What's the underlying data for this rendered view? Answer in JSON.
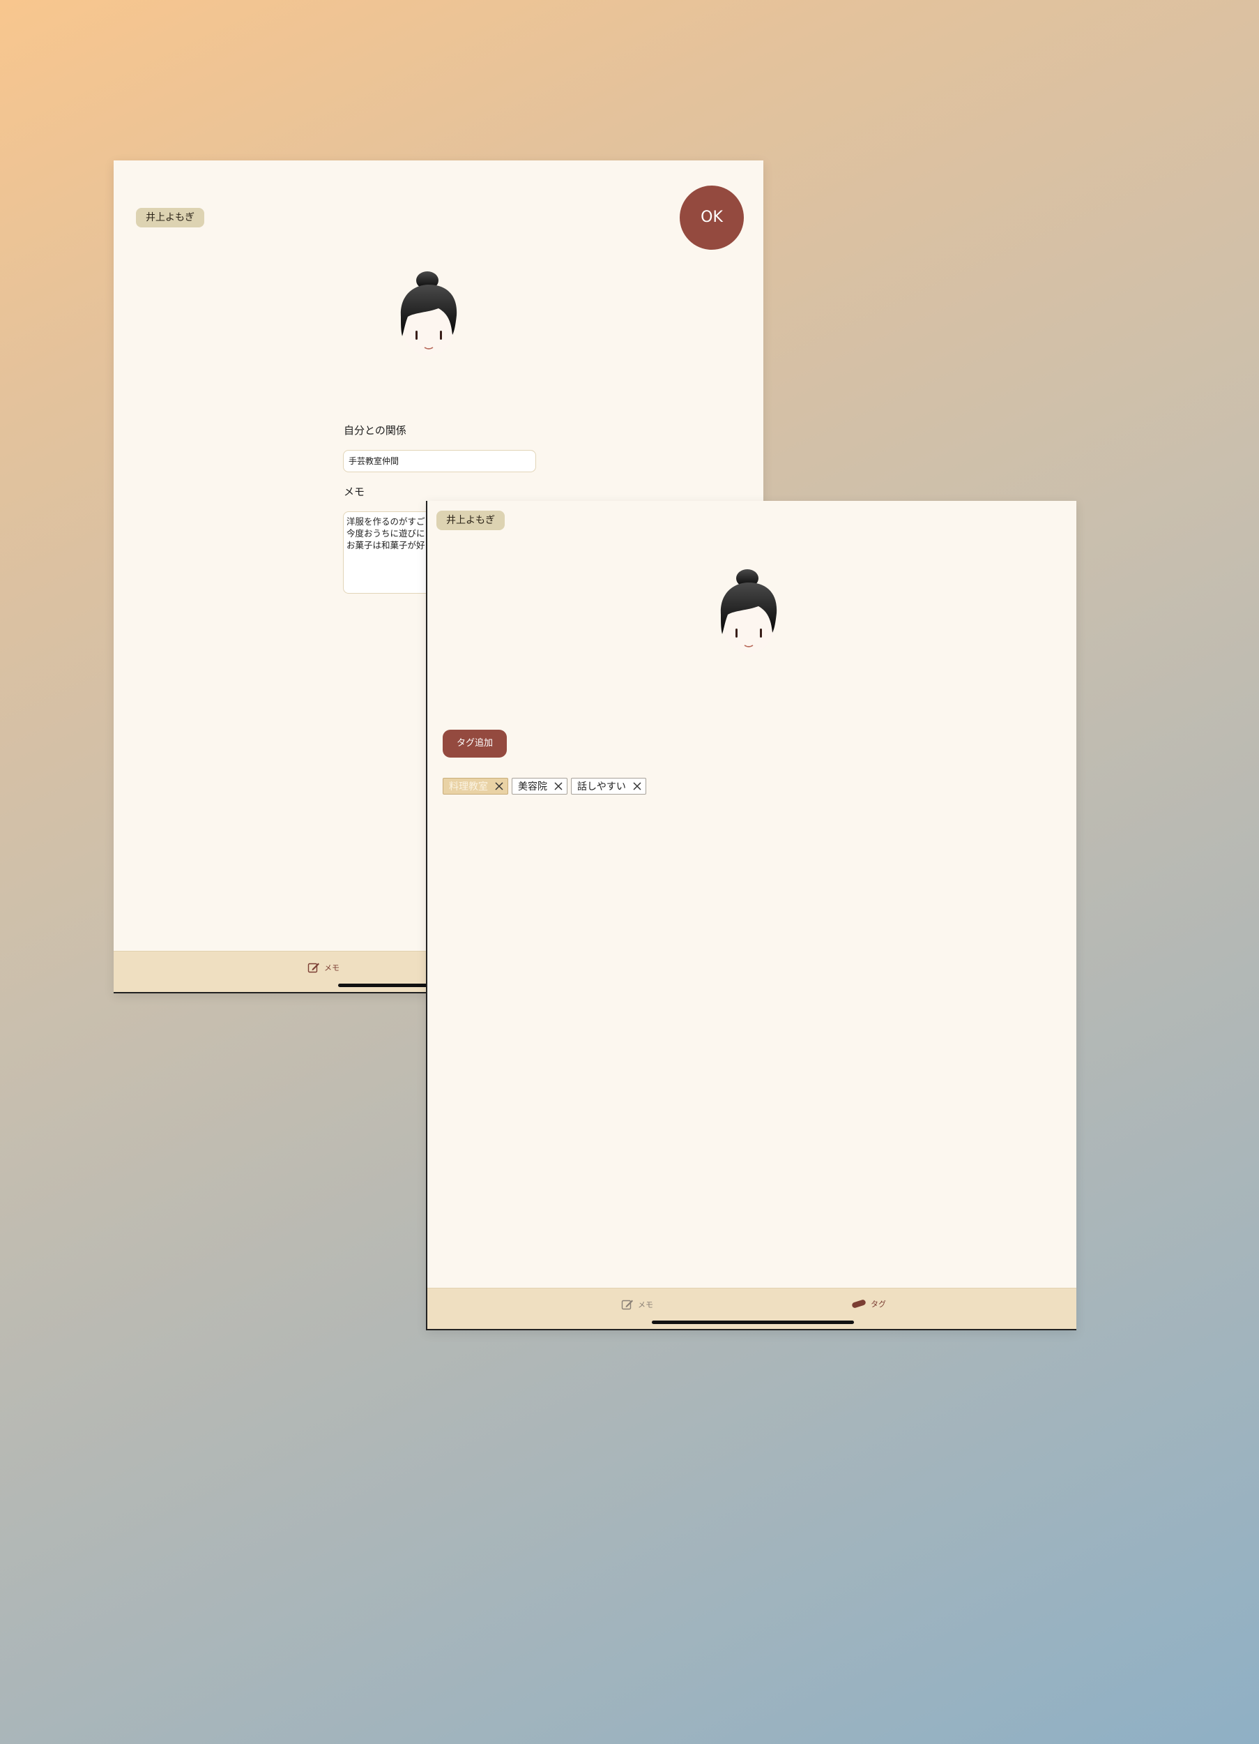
{
  "memo_screen": {
    "name_chip": "井上よもぎ",
    "ok_label": "OK",
    "relation_label": "自分との関係",
    "relation_value": "手芸教室仲間",
    "memo_label": "メモ",
    "memo_lines": [
      "洋服を作るのがすご",
      "今度おうちに遊びに",
      "お菓子は和菓子が好"
    ],
    "tab_memo_label": "メモ"
  },
  "tag_screen": {
    "name_chip": "井上よもぎ",
    "tag_add_label": "タグ追加",
    "tags": [
      {
        "label": "料理教室",
        "selected": true
      },
      {
        "label": "美容院",
        "selected": false
      },
      {
        "label": "話しやすい",
        "selected": false
      }
    ],
    "tab_memo_label": "メモ",
    "tab_tag_label": "タグ"
  },
  "icons": {
    "memo_tab": "pencil-square-icon",
    "tag_tab": "bandage-icon",
    "tag_remove": "close-icon"
  },
  "colors": {
    "accent": "#944a3f",
    "screen_bg": "#fcf7ef",
    "tab_bar_bg": "#efdfc1",
    "name_chip_bg": "#ddd3b2"
  }
}
